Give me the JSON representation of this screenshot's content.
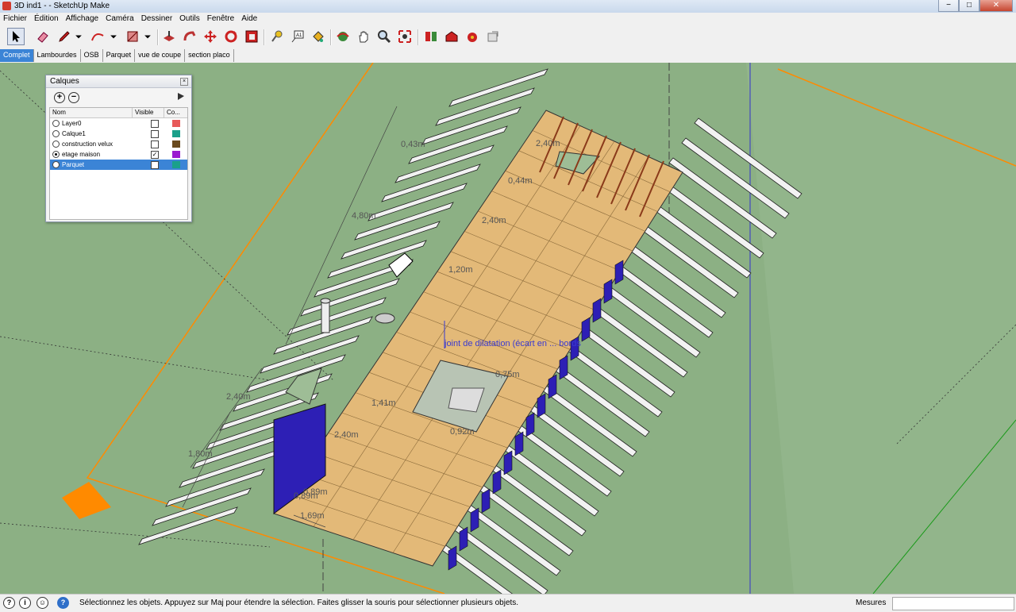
{
  "window": {
    "title": "3D ind1 - - SketchUp Make",
    "buttons": [
      "−",
      "□",
      "✕"
    ]
  },
  "menu": [
    "Fichier",
    "Édition",
    "Affichage",
    "Caméra",
    "Dessiner",
    "Outils",
    "Fenêtre",
    "Aide"
  ],
  "toolbar": {
    "tools": [
      "select-icon",
      "eraser-icon",
      "pencil-icon",
      "dropdown-arrow-icon",
      "arc-icon",
      "dropdown-arrow-icon",
      "rectangle-icon",
      "dropdown-arrow-icon",
      "push-pull-icon",
      "follow-me-icon",
      "move-icon",
      "rotate-icon",
      "offset-icon",
      "tape-measure-icon",
      "text-icon",
      "paint-bucket-icon",
      "orbit-icon",
      "pan-icon",
      "zoom-icon",
      "zoom-extents-icon",
      "components-icon",
      "warehouse-icon",
      "extension-icon",
      "share-icon"
    ]
  },
  "scene_tabs": [
    {
      "label": "Complet",
      "active": true
    },
    {
      "label": "Lambourdes",
      "active": false
    },
    {
      "label": "OSB",
      "active": false
    },
    {
      "label": "Parquet",
      "active": false
    },
    {
      "label": "vue de coupe",
      "active": false
    },
    {
      "label": "section placo",
      "active": false
    }
  ],
  "layers_panel": {
    "title": "Calques",
    "columns": {
      "name": "Nom",
      "visible": "Visible",
      "color": "Co..."
    },
    "layers": [
      {
        "name": "Layer0",
        "active": false,
        "visible": false,
        "color": "#e85a5a",
        "selected": false
      },
      {
        "name": "Calque1",
        "active": false,
        "visible": false,
        "color": "#1aa08a",
        "selected": false
      },
      {
        "name": "construction velux",
        "active": false,
        "visible": false,
        "color": "#6a4a1e",
        "selected": false
      },
      {
        "name": "etage maison",
        "active": true,
        "visible": true,
        "color": "#9a1ad0",
        "selected": false
      },
      {
        "name": "Parquet",
        "active": false,
        "visible": false,
        "color": "#1aa08a",
        "selected": true
      }
    ]
  },
  "dimensions": [
    "0,43m",
    "2,40m",
    "0,44m",
    "4,80m",
    "2,40m",
    "1,20m",
    "0,75m",
    "1,41m",
    "0,92m",
    "2,40m",
    "2,40m",
    "1,80m",
    "0,89m",
    "0,89m",
    "1,69m"
  ],
  "annotation": "joint de dilatation (écart en ... bords",
  "statusbar": {
    "message": "Sélectionnez les objets. Appuyez sur Maj pour étendre la sélection. Faites glisser la souris pour sélectionner plusieurs objets.",
    "measures_label": "Mesures",
    "measures_value": ""
  }
}
